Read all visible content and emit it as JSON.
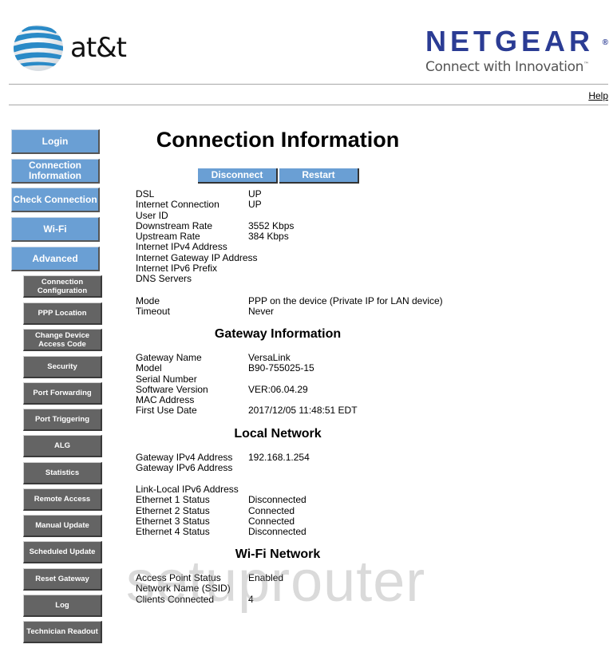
{
  "header": {
    "att_logo_text": "at&t",
    "netgear_name": "NETGEAR",
    "netgear_reg": "®",
    "netgear_tagline": "Connect with Innovation",
    "netgear_tm": "™",
    "help_link": "Help"
  },
  "sidebar": {
    "main_items": [
      {
        "label": "Login"
      },
      {
        "label": "Connection Information"
      },
      {
        "label": "Check Connection"
      },
      {
        "label": "Wi-Fi"
      },
      {
        "label": "Advanced"
      }
    ],
    "sub_items": [
      {
        "label": "Connection Configuration"
      },
      {
        "label": "PPP Location"
      },
      {
        "label": "Change Device Access Code"
      },
      {
        "label": "Security"
      },
      {
        "label": "Port Forwarding"
      },
      {
        "label": "Port Triggering"
      },
      {
        "label": "ALG"
      },
      {
        "label": "Statistics"
      },
      {
        "label": "Remote Access"
      },
      {
        "label": "Manual Update"
      },
      {
        "label": "Scheduled Update"
      },
      {
        "label": "Reset Gateway"
      },
      {
        "label": "Log"
      },
      {
        "label": "Technician Readout"
      }
    ]
  },
  "main": {
    "title": "Connection Information",
    "buttons": {
      "disconnect": "Disconnect",
      "restart": "Restart"
    },
    "connection": [
      {
        "label": "DSL",
        "value": "UP"
      },
      {
        "label": "Internet Connection",
        "value": "UP"
      },
      {
        "label": "User ID",
        "value": ""
      },
      {
        "label": "Downstream Rate",
        "value": "3552 Kbps"
      },
      {
        "label": "Upstream Rate",
        "value": "384 Kbps"
      },
      {
        "label": "Internet IPv4 Address",
        "value": ""
      },
      {
        "label": "Internet Gateway IP Address",
        "value": ""
      },
      {
        "label": "Internet IPv6 Prefix",
        "value": ""
      },
      {
        "label": "DNS Servers",
        "value": ""
      }
    ],
    "mode": [
      {
        "label": "Mode",
        "value": "PPP on the device (Private IP for LAN device)"
      },
      {
        "label": "Timeout",
        "value": "Never"
      }
    ],
    "gateway": {
      "title": "Gateway Information",
      "rows": [
        {
          "label": "Gateway Name",
          "value": "VersaLink"
        },
        {
          "label": "Model",
          "value": "B90-755025-15"
        },
        {
          "label": "Serial Number",
          "value": ""
        },
        {
          "label": "Software Version",
          "value": "VER:06.04.29"
        },
        {
          "label": "MAC Address",
          "value": ""
        },
        {
          "label": "First Use Date",
          "value": "2017/12/05 11:48:51 EDT"
        }
      ]
    },
    "local": {
      "title": "Local Network",
      "rows_a": [
        {
          "label": "Gateway IPv4 Address",
          "value": "192.168.1.254"
        },
        {
          "label": "Gateway IPv6 Address",
          "value": ""
        }
      ],
      "rows_b": [
        {
          "label": "Link-Local IPv6 Address",
          "value": ""
        },
        {
          "label": "Ethernet 1 Status",
          "value": "Disconnected"
        },
        {
          "label": "Ethernet 2 Status",
          "value": "Connected"
        },
        {
          "label": "Ethernet 3 Status",
          "value": "Connected"
        },
        {
          "label": "Ethernet 4 Status",
          "value": "Disconnected"
        }
      ]
    },
    "wifi": {
      "title": "Wi-Fi Network",
      "rows": [
        {
          "label": "Access Point Status",
          "value": "Enabled"
        },
        {
          "label": "Network Name (SSID)",
          "value": ""
        },
        {
          "label": "Clients Connected",
          "value": "4"
        }
      ]
    }
  },
  "watermark": "setuprouter",
  "colors": {
    "main_nav": "#6a9fd4",
    "sub_nav": "#646464",
    "netgear_blue": "#2b3c94"
  }
}
